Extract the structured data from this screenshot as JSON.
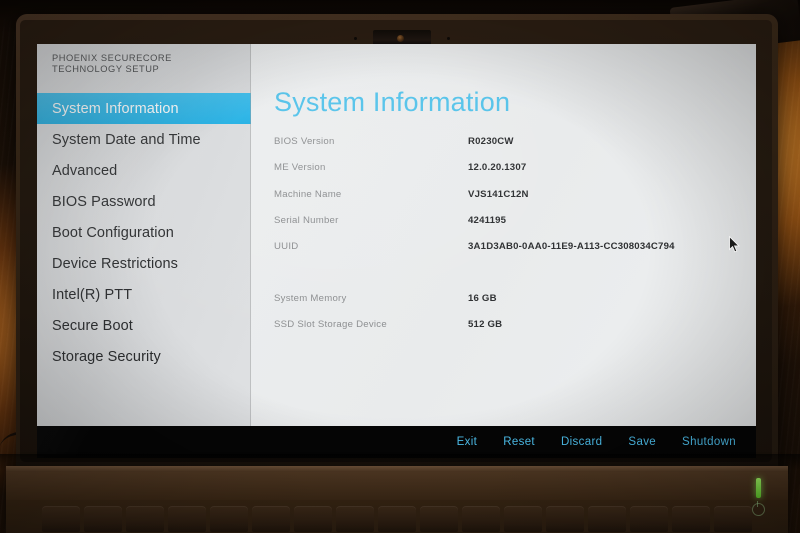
{
  "brand": {
    "title": "PHOENIX SECURECORE\nTECHNOLOGY SETUP"
  },
  "sidebar": {
    "items": [
      {
        "label": "System Information",
        "active": true
      },
      {
        "label": "System Date and Time",
        "active": false
      },
      {
        "label": "Advanced",
        "active": false
      },
      {
        "label": "BIOS Password",
        "active": false
      },
      {
        "label": "Boot Configuration",
        "active": false
      },
      {
        "label": "Device Restrictions",
        "active": false
      },
      {
        "label": "Intel(R) PTT",
        "active": false
      },
      {
        "label": "Secure Boot",
        "active": false
      },
      {
        "label": "Storage Security",
        "active": false
      }
    ]
  },
  "main": {
    "title": "System Information",
    "rows": [
      {
        "label": "BIOS Version",
        "value": "R0230CW",
        "gap_after": false
      },
      {
        "label": "ME Version",
        "value": "12.0.20.1307",
        "gap_after": false
      },
      {
        "label": "Machine Name",
        "value": "VJS141C12N",
        "gap_after": false
      },
      {
        "label": "Serial Number",
        "value": "4241195",
        "gap_after": false
      },
      {
        "label": "UUID",
        "value": "3A1D3AB0-0AA0-11E9-A113-CC308034C794",
        "gap_after": true
      },
      {
        "label": "System Memory",
        "value": "16 GB",
        "gap_after": false
      },
      {
        "label": "SSD Slot Storage Device",
        "value": "512 GB",
        "gap_after": false
      }
    ]
  },
  "action_bar": {
    "buttons": [
      {
        "label": "Exit"
      },
      {
        "label": "Reset"
      },
      {
        "label": "Discard"
      },
      {
        "label": "Save"
      },
      {
        "label": "Shutdown"
      }
    ]
  },
  "colors": {
    "accent": "#22b0e4",
    "title": "#55c3ea",
    "action_text": "#4ec2f0",
    "panel_bg": "#eceef0",
    "sidebar_bg": "#d7d9db",
    "bezel": "#2e2013",
    "led_green": "#7ee040"
  },
  "hardware": {
    "webcam": "webcam-lens",
    "power_led": "power-indicator"
  },
  "pointer": {
    "label": "mouse-cursor"
  }
}
